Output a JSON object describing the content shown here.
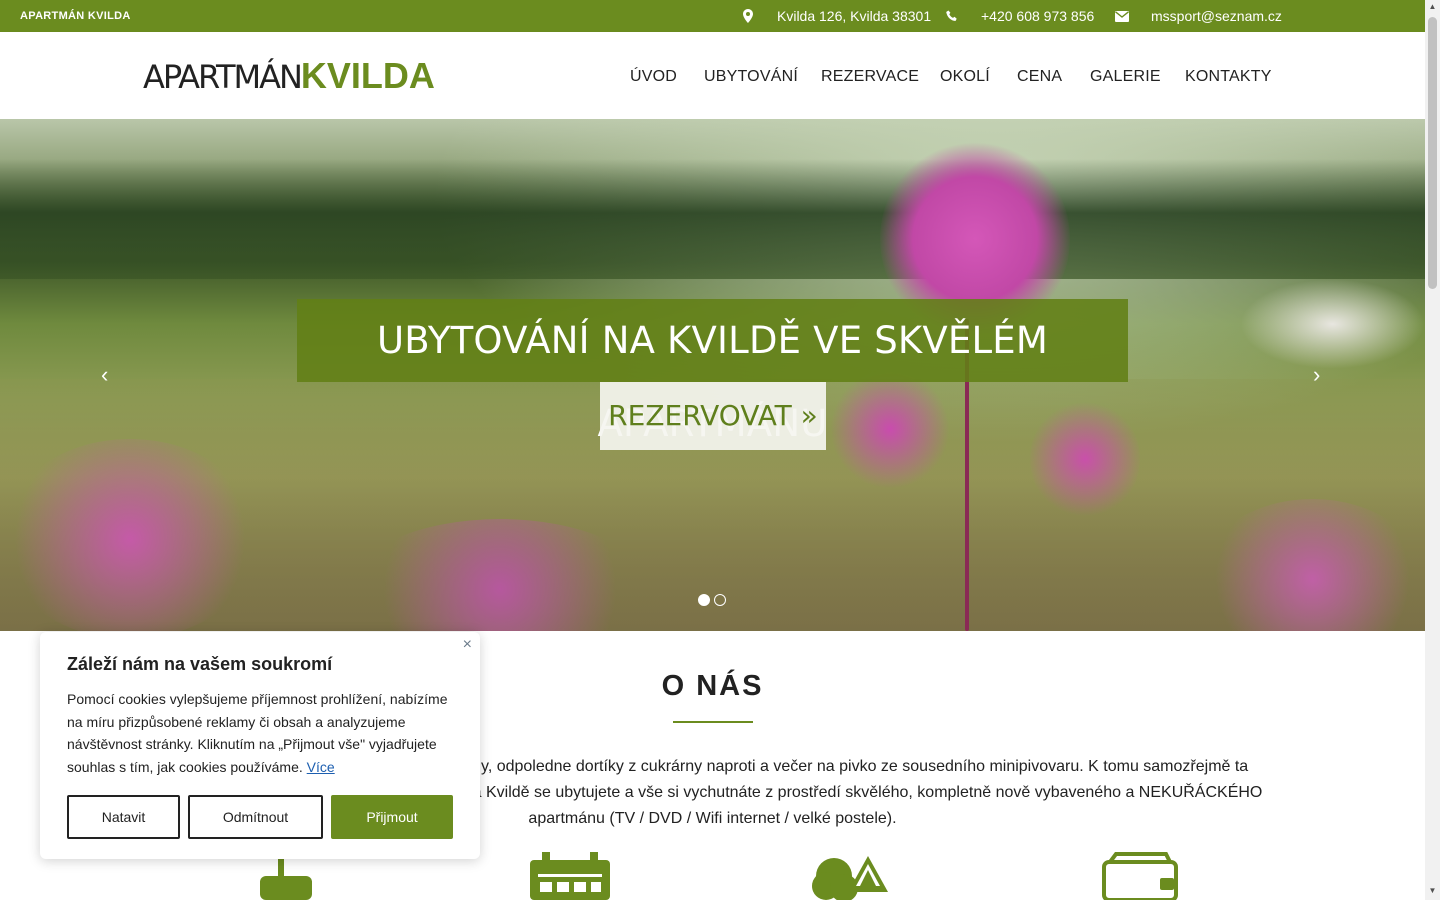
{
  "topbar": {
    "brand": "APARTMÁN KVILDA",
    "address": "Kvilda 126, Kvilda 38301",
    "phone": "+420 608 973 856",
    "email": "mssport@seznam.cz",
    "address_icon": "map-marker-icon",
    "phone_icon": "phone-icon",
    "email_icon": "envelope-icon"
  },
  "logo": {
    "thin": "APARTMÁN",
    "bold": "KVILDA"
  },
  "nav": [
    "ÚVOD",
    "UBYTOVÁNÍ",
    "REZERVACE",
    "OKOLÍ",
    "CENA",
    "GALERIE",
    "KONTAKTY"
  ],
  "hero": {
    "title": "UBYTOVÁNÍ NA KVILDĚ VE SKVĚLÉM APARTMÁNU",
    "button": "REZERVOVAT »",
    "prev": "‹",
    "next": "›",
    "slides": 2,
    "active_slide": 1
  },
  "about": {
    "title": "O NÁS",
    "line1": "rny, odpoledne dortíky z cukrárny naproti a večer na pivko ze sousedního minipivovaru. K tomu samozřejmě ta",
    "line2": "a Kvildě se ubytujete a vše si vychutnáte z prostředí skvělého, kompletně nově vybaveného a NEKUŘÁCKÉHO",
    "line3": "apartmánu (TV / DVD / Wifi internet / velké postele).",
    "icons": [
      "suitcase-icon",
      "calendar-icon",
      "trees-icon",
      "wallet-icon"
    ]
  },
  "cookie": {
    "title": "Záleží nám na vašem soukromí",
    "text": "Pomocí cookies vylepšujeme příjemnost prohlížení, nabízíme na míru přizpůsobené reklamy či obsah a analyzujeme návštěvnost stránky. Kliknutím na „Přijmout vše\" vyjadřujete souhlas s tím, jak cookies používáme.",
    "more": "Více",
    "close": "×",
    "btn_settings": "Natavit",
    "btn_reject": "Odmítnout",
    "btn_accept": "Přijmout"
  },
  "colors": {
    "brand": "#6b8c1f",
    "text": "#222222",
    "link": "#1d5fb0"
  }
}
